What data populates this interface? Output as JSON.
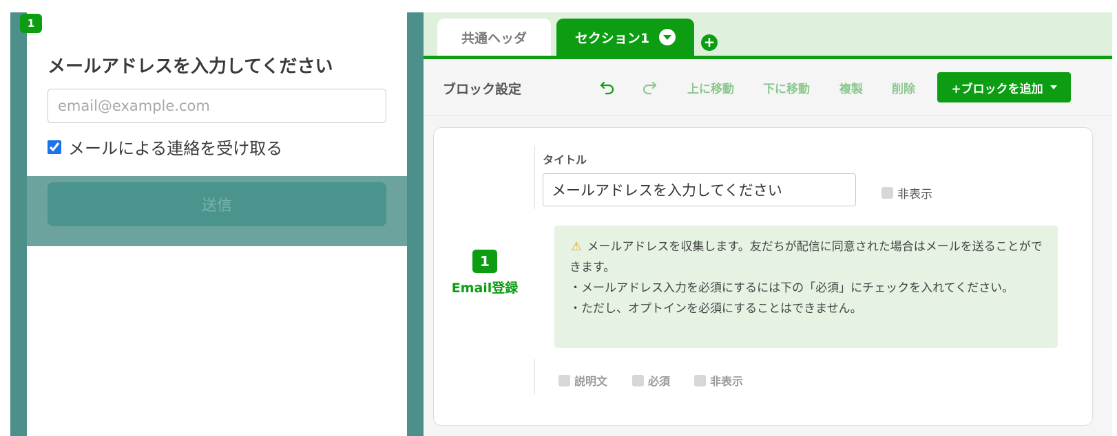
{
  "preview": {
    "badge": "1",
    "heading": "メールアドレスを入力してください",
    "email_placeholder": "email@example.com",
    "optin_label": "メールによる連絡を受け取る",
    "optin_checked": true,
    "submit_label": "送信"
  },
  "tabs": {
    "common": "共通ヘッダ",
    "section": "セクション1",
    "add_icon": "plus-icon",
    "dropdown_icon": "chevron-down-icon"
  },
  "toolbar": {
    "title": "ブロック設定",
    "undo_icon": "undo-icon",
    "redo_icon": "redo-icon",
    "move_up": "上に移動",
    "move_down": "下に移動",
    "duplicate": "複製",
    "delete": "削除",
    "add_block": "+ブロックを追加"
  },
  "block": {
    "number": "1",
    "type": "Email登録",
    "title_label": "タイトル",
    "title_value": "メールアドレスを入力してください",
    "hide_label": "非表示",
    "notice": {
      "icon": "warning-icon",
      "line1": "メールアドレスを収集します。友だちが配信に同意された場合はメールを送ることができます。",
      "line2": "・メールアドレス入力を必須にするには下の「必須」にチェックを入れてください。",
      "line3": "・ただし、オプトインを必須にすることはできません。"
    },
    "options": {
      "description": "説明文",
      "required": "必須",
      "hide": "非表示"
    }
  },
  "colors": {
    "brand_green": "#0c9d12",
    "preview_frame": "#4d8f8a",
    "notice_bg": "#e6f3e3"
  }
}
